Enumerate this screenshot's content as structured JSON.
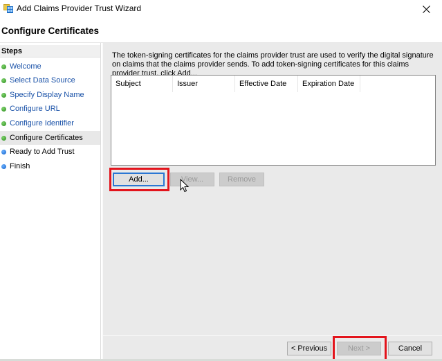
{
  "window": {
    "title": "Add Claims Provider Trust Wizard",
    "icon": "wizard-app-icon",
    "close_icon": "close-icon"
  },
  "page": {
    "title": "Configure Certificates"
  },
  "sidebar": {
    "header": "Steps",
    "items": [
      {
        "label": "Welcome",
        "status": "complete",
        "dot_color": "#2a8a1c",
        "style": "link"
      },
      {
        "label": "Select Data Source",
        "status": "complete",
        "dot_color": "#2a8a1c",
        "style": "link"
      },
      {
        "label": "Specify Display Name",
        "status": "complete",
        "dot_color": "#2a8a1c",
        "style": "link"
      },
      {
        "label": "Configure URL",
        "status": "complete",
        "dot_color": "#2a8a1c",
        "style": "link"
      },
      {
        "label": "Configure Identifier",
        "status": "complete",
        "dot_color": "#2a8a1c",
        "style": "link"
      },
      {
        "label": "Configure Certificates",
        "status": "current",
        "dot_color": "#2a8a1c",
        "style": "plain"
      },
      {
        "label": "Ready to Add Trust",
        "status": "pending",
        "dot_color": "#1160c8",
        "style": "plain"
      },
      {
        "label": "Finish",
        "status": "pending",
        "dot_color": "#1160c8",
        "style": "plain"
      }
    ]
  },
  "main": {
    "description": "The token-signing certificates for the claims provider trust are used to verify the digital signature on claims that the claims provider sends. To add token-signing certificates for this claims provider trust, click Add...",
    "certificate_list": {
      "columns": [
        "Subject",
        "Issuer",
        "Effective Date",
        "Expiration Date"
      ],
      "rows": []
    },
    "buttons": {
      "add": "Add...",
      "view": "View...",
      "remove": "Remove"
    }
  },
  "footer": {
    "previous": "< Previous",
    "next": "Next >",
    "cancel": "Cancel"
  },
  "annotations": {
    "highlight_color": "#e3141c"
  }
}
